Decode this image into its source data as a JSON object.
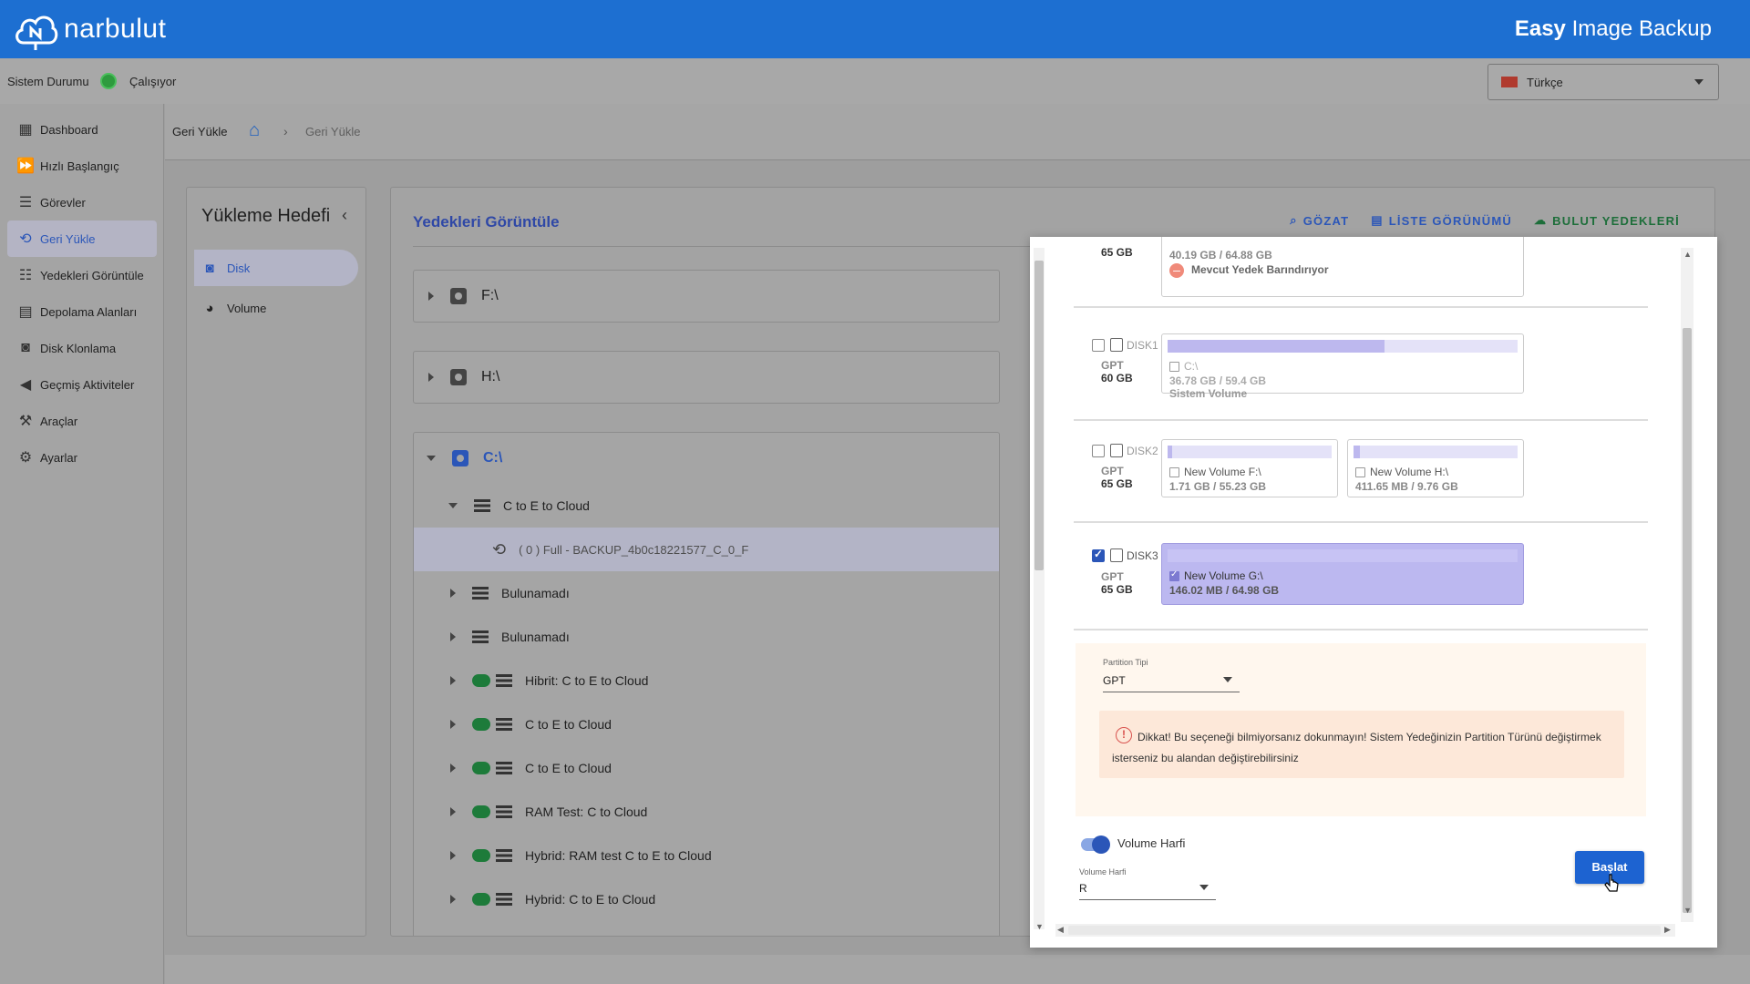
{
  "header": {
    "logo_text": "narbulut",
    "app_title_bold": "Easy",
    "app_title_rest": " Image Backup"
  },
  "status": {
    "label": "Sistem Durumu",
    "value": "Çalışıyor",
    "color": "#2e9b3e"
  },
  "language": {
    "selected": "Türkçe",
    "flag_icon": "turkey-flag-icon"
  },
  "sidebar": {
    "items": [
      {
        "label": "Dashboard",
        "icon": "dashboard-icon",
        "active": false
      },
      {
        "label": "Hızlı Başlangıç",
        "icon": "fast-forward-icon",
        "active": false
      },
      {
        "label": "Görevler",
        "icon": "list-icon",
        "active": false
      },
      {
        "label": "Geri Yükle",
        "icon": "restore-icon",
        "active": true
      },
      {
        "label": "Yedekleri Görüntüle",
        "icon": "list-bullets-icon",
        "active": false
      },
      {
        "label": "Depolama Alanları",
        "icon": "storage-icon",
        "active": false
      },
      {
        "label": "Disk Klonlama",
        "icon": "disk-icon",
        "active": false
      },
      {
        "label": "Geçmiş Aktiviteler",
        "icon": "history-icon",
        "active": false
      },
      {
        "label": "Araçlar",
        "icon": "tools-icon",
        "active": false
      },
      {
        "label": "Ayarlar",
        "icon": "gear-icon",
        "active": false
      }
    ]
  },
  "breadcrumb": {
    "title": "Geri Yükle",
    "current": "Geri Yükle"
  },
  "target_panel": {
    "title": "Yükleme Hedefi",
    "items": [
      {
        "label": "Disk",
        "active": true
      },
      {
        "label": "Volume",
        "active": false
      }
    ]
  },
  "main": {
    "title": "Yedekleri Görüntüle",
    "toolbar": {
      "browse": "GÖZAT",
      "list_view": "LİSTE GÖRÜNÜMÜ",
      "cloud_backups": "BULUT YEDEKLERİ"
    },
    "drives": [
      {
        "label": "F:\\",
        "expanded": false
      },
      {
        "label": "H:\\",
        "expanded": false
      },
      {
        "label": "C:\\",
        "expanded": true
      }
    ],
    "tree": {
      "group_label": "C to E to Cloud",
      "selected_backup": "( 0 ) Full - BACKUP_4b0c18221577_C_0_F",
      "rows": [
        {
          "label": "Bulunamadı",
          "cloud": false
        },
        {
          "label": "Bulunamadı",
          "cloud": false
        },
        {
          "label": "Hibrit: C to E to Cloud",
          "cloud": true
        },
        {
          "label": "C to E to Cloud",
          "cloud": true
        },
        {
          "label": "C to E to Cloud",
          "cloud": true
        },
        {
          "label": "RAM Test: C to Cloud",
          "cloud": true
        },
        {
          "label": "Hybrid: RAM test C to E to Cloud",
          "cloud": true
        },
        {
          "label": "Hybrid: C to E to Cloud",
          "cloud": true
        }
      ]
    }
  },
  "dialog": {
    "top_disk": {
      "size": "65 GB",
      "usage": "40.19 GB / 64.88 GB",
      "warning": "Mevcut Yedek Barındırıyor"
    },
    "disks": [
      {
        "name": "DISK1",
        "type": "GPT",
        "size": "60 GB",
        "checked": false,
        "volumes": [
          {
            "name": "C:\\",
            "usage": "36.78 GB / 59.4 GB",
            "extra": "Sistem Volume",
            "fill": 0.62,
            "checked": false
          }
        ]
      },
      {
        "name": "DISK2",
        "type": "GPT",
        "size": "65 GB",
        "checked": false,
        "volumes": [
          {
            "name": "New Volume F:\\",
            "usage": "1.71 GB / 55.23 GB",
            "fill": 0.03,
            "checked": false
          },
          {
            "name": "New Volume H:\\",
            "usage": "411.65 MB / 9.76 GB",
            "fill": 0.04,
            "checked": false
          }
        ]
      },
      {
        "name": "DISK3",
        "type": "GPT",
        "size": "65 GB",
        "checked": true,
        "volumes": [
          {
            "name": "New Volume G:\\",
            "usage": "146.02 MB / 64.98 GB",
            "fill": 0.0,
            "checked": true
          }
        ]
      }
    ],
    "partition": {
      "label": "Partition Tipi",
      "value": "GPT"
    },
    "alert": "Dikkat! Bu seçeneği bilmiyorsanız dokunmayın! Sistem Yedeğinizin Partition Türünü değiştirmek isterseniz bu alandan değiştirebilirsiniz",
    "volume_letter_toggle": "Volume Harfi",
    "volume_letter": {
      "label": "Volume Harfi",
      "value": "R"
    },
    "start_button": "Başlat"
  },
  "colors": {
    "brand": "#1d6fd1",
    "accent": "#2b56b8",
    "success": "#2e9b3e"
  }
}
